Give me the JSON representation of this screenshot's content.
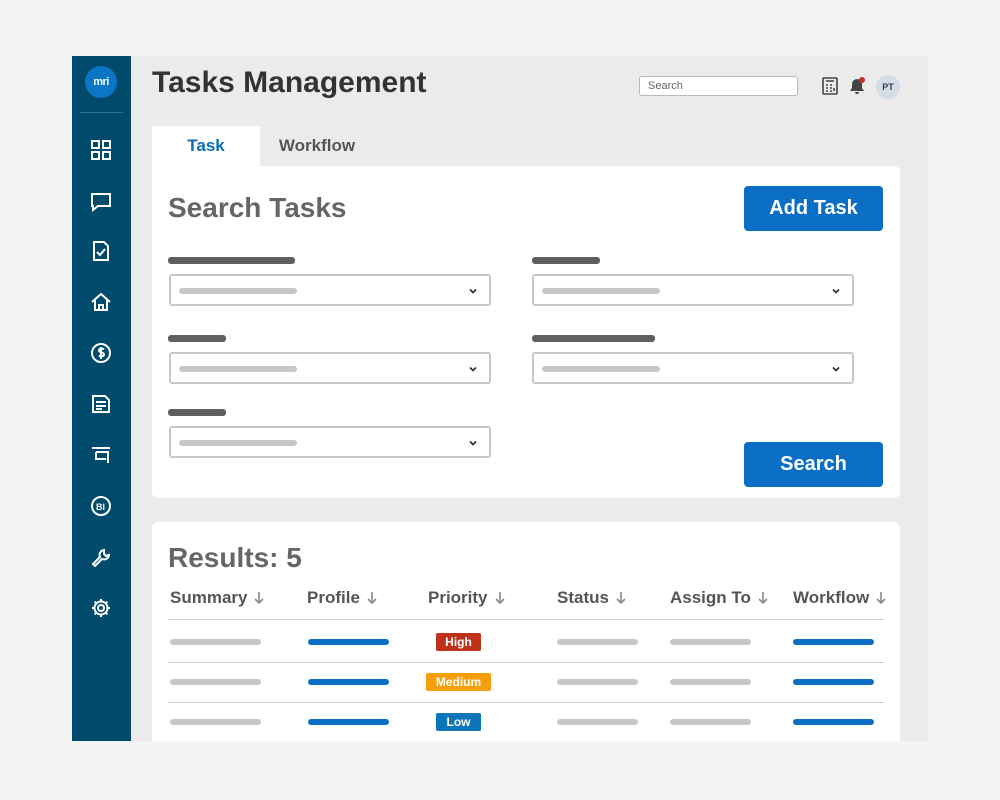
{
  "app": {
    "logo_text": "mri",
    "title": "Tasks Management",
    "search_placeholder": "Search",
    "avatar_initials": "PT",
    "accent_color": "#0a6fc4",
    "sidebar_color": "#004a6b"
  },
  "sidebar": {
    "items": [
      {
        "icon": "dashboard-icon"
      },
      {
        "icon": "chat-icon"
      },
      {
        "icon": "task-checklist-icon"
      },
      {
        "icon": "home-icon"
      },
      {
        "icon": "dollar-icon"
      },
      {
        "icon": "document-icon"
      },
      {
        "icon": "reports-icon"
      },
      {
        "icon": "bi-icon"
      },
      {
        "icon": "wrench-icon"
      },
      {
        "icon": "settings-gear-icon"
      }
    ]
  },
  "header_icons": [
    "calculator-icon",
    "notification-bell-icon"
  ],
  "tabs": [
    {
      "label": "Task",
      "active": true
    },
    {
      "label": "Workflow",
      "active": false
    }
  ],
  "search_panel": {
    "title": "Search Tasks",
    "add_button": "Add Task",
    "search_button": "Search"
  },
  "results": {
    "title": "Results: 5",
    "columns": [
      "Summary",
      "Profile",
      "Priority",
      "Status",
      "Assign To",
      "Workflow"
    ],
    "rows": [
      {
        "priority": "High",
        "priority_color": "#c0311a"
      },
      {
        "priority": "Medium",
        "priority_color": "#f5a00a"
      },
      {
        "priority": "Low",
        "priority_color": "#0a75b8"
      }
    ]
  }
}
